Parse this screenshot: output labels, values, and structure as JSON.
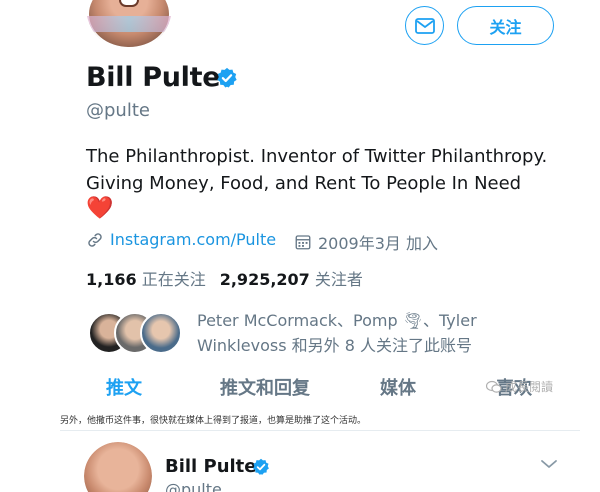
{
  "profile": {
    "name": "Bill Pulte",
    "handle": "@pulte",
    "bio": "The Philanthropist. Inventor of Twitter Philanthropy. Giving Money, Food, and Rent To People In Need",
    "bio_emoji": "❤️",
    "link": "Instagram.com/Pulte",
    "joined": "2009年3月 加入",
    "following_count": "1,166",
    "following_label": "正在关注",
    "followers_count": "2,925,207",
    "followers_label": "关注者",
    "followed_by": "Peter McCormack、Pomp 🌪、Tyler Winklevoss 和另外 8 人关注了此账号"
  },
  "actions": {
    "follow_label": "关注"
  },
  "tabs": [
    {
      "label": "推文",
      "active": true
    },
    {
      "label": "推文和回复",
      "active": false
    },
    {
      "label": "媒体",
      "active": false
    },
    {
      "label": "喜欢",
      "active": false
    }
  ],
  "watermark": "成長閱讀",
  "caption": "另外，他撒币这件事，很快就在媒体上得到了报道，也算是助推了这个活动。",
  "tweet": {
    "name": "Bill Pulte",
    "handle": "@pulte"
  },
  "colors": {
    "accent": "#1da1f2",
    "link": "#1b95e0",
    "secondary_text": "#657786",
    "heart": "#e0245e"
  }
}
